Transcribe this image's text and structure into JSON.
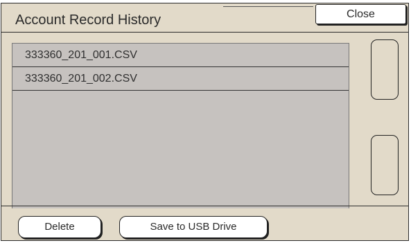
{
  "window": {
    "title": "Account Record History"
  },
  "toolbar": {
    "close_label": "Close"
  },
  "file_list": {
    "items": [
      {
        "name": "333360_201_001.CSV"
      },
      {
        "name": "333360_201_002.CSV"
      }
    ]
  },
  "actions": {
    "delete_label": "Delete",
    "save_usb_label": "Save to USB Drive"
  },
  "colors": {
    "window_background": "#e2dac9",
    "list_background": "#c6c2bf",
    "button_background": "#ffffff",
    "border": "#2a2a2a"
  }
}
